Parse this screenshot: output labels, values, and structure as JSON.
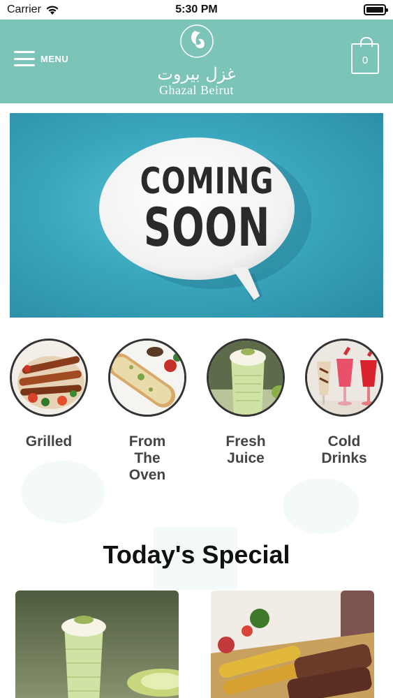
{
  "status_bar": {
    "carrier": "Carrier",
    "time": "5:30 PM"
  },
  "header": {
    "menu_label": "MENU",
    "logo_arabic": "غزل بيروت",
    "logo_latin": "Ghazal Beirut",
    "cart_count": "0"
  },
  "banner": {
    "line1": "COMING",
    "line2": "SOON"
  },
  "categories": [
    {
      "label": "Grilled"
    },
    {
      "label": "From The Oven"
    },
    {
      "label": "Fresh Juice"
    },
    {
      "label": "Cold Drinks"
    }
  ],
  "section": {
    "title": "Today's Special"
  },
  "colors": {
    "header_bg": "#7cc3b8",
    "banner_bg": "#3aa7be"
  }
}
